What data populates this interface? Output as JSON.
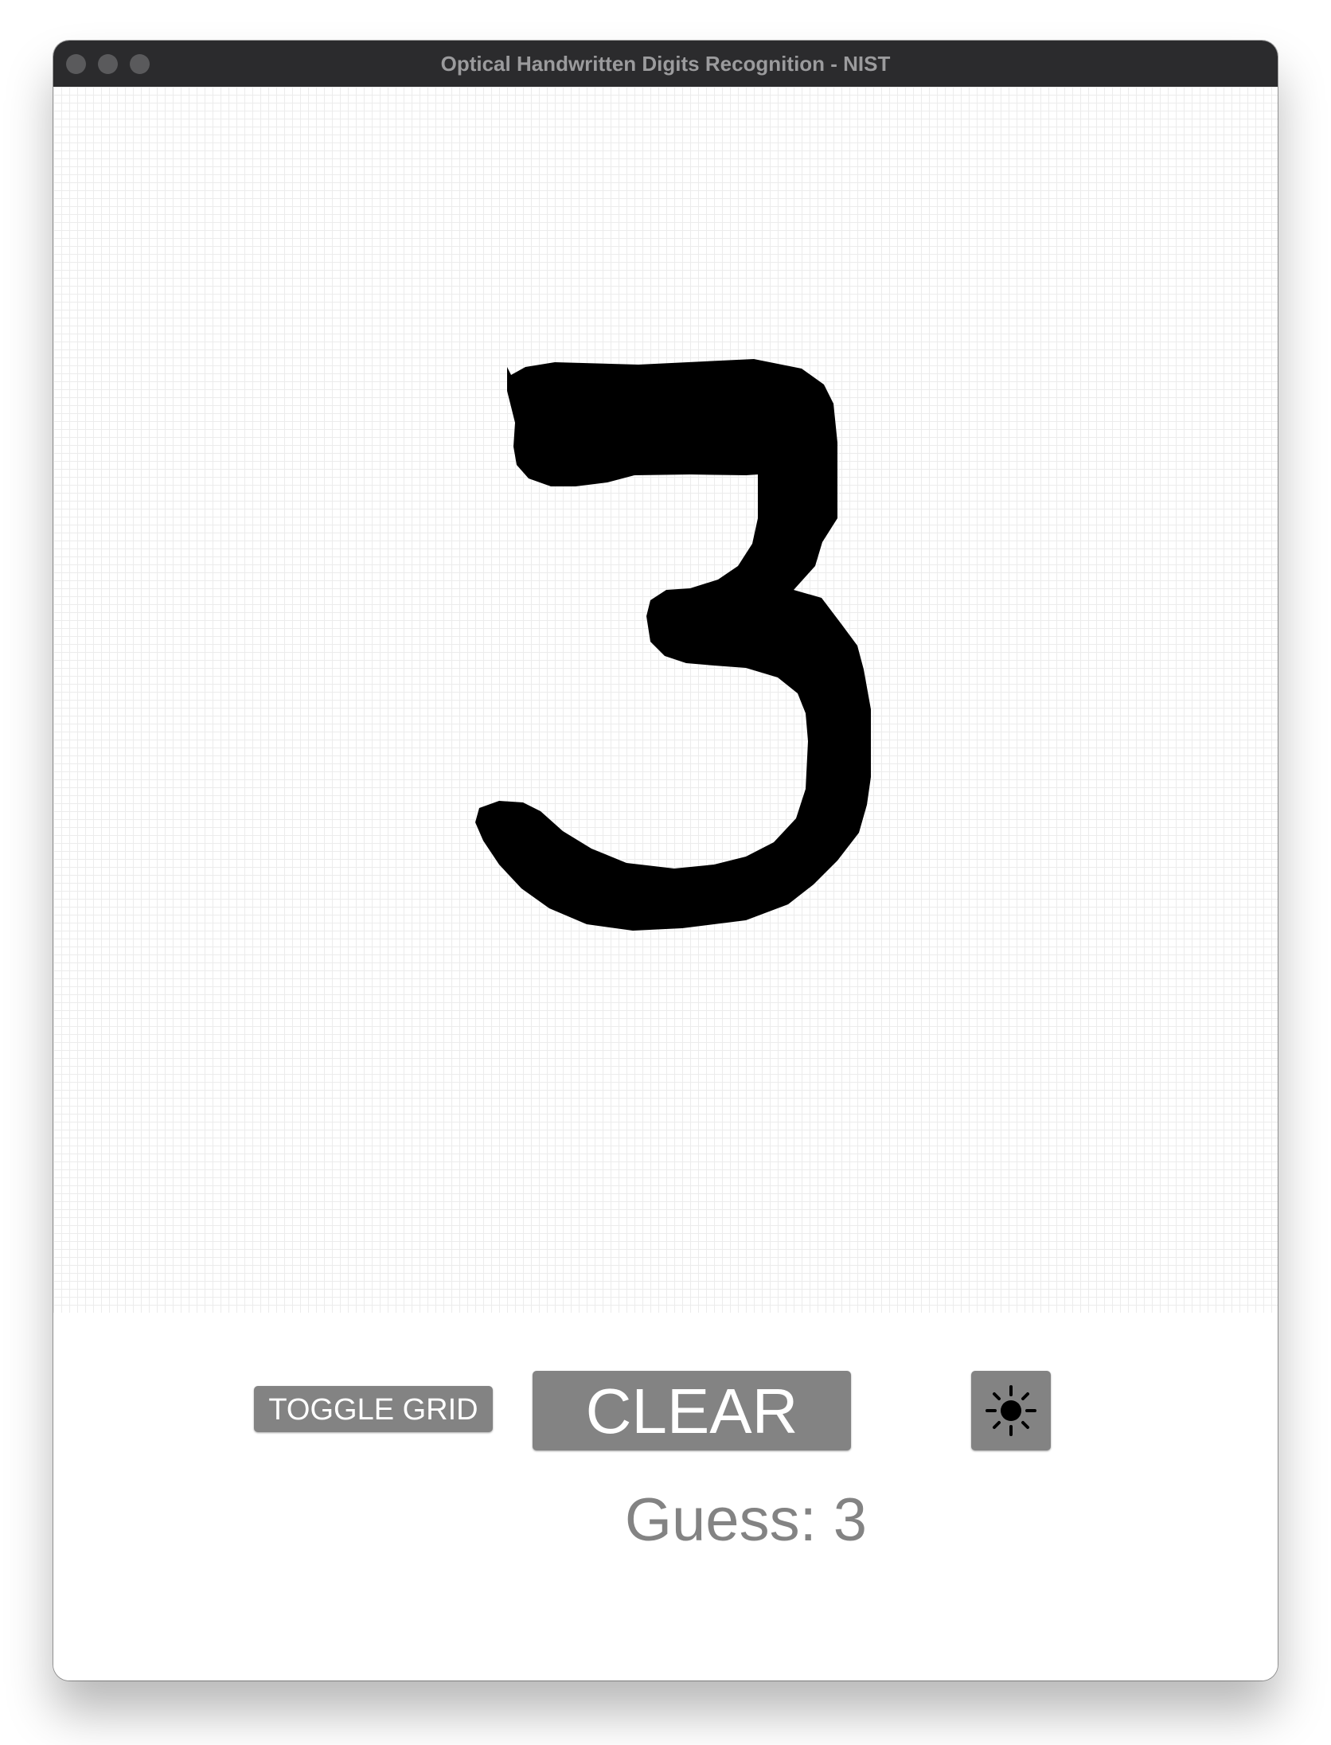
{
  "window": {
    "title": "Optical Handwritten Digits Recognition - NIST"
  },
  "canvas": {
    "grid_visible": true,
    "drawn_digit": "3"
  },
  "controls": {
    "toggle_grid_label": "TOGGLE GRID",
    "clear_label": "CLEAR",
    "theme_icon": "sun-icon"
  },
  "result": {
    "guess_text": "Guess: 3"
  },
  "colors": {
    "titlebar": "#2b2b2d",
    "button": "#838383",
    "ink": "#000000",
    "grid": "#ececec"
  }
}
